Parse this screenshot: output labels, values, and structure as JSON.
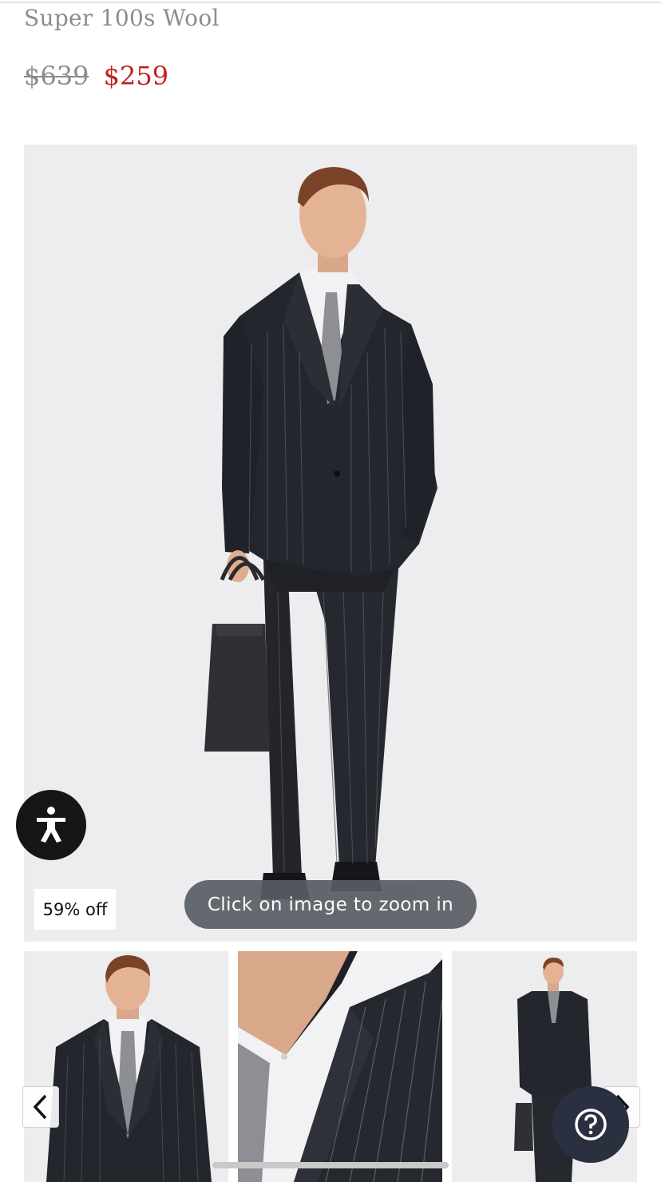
{
  "product": {
    "subtitle": "Super 100s Wool",
    "original_price": "$639",
    "sale_price": "$259"
  },
  "gallery": {
    "discount_badge": "59% off",
    "zoom_hint": "Click on image to zoom in",
    "main_image_alt": "model-in-navy-pinstripe-suit-holding-briefcase",
    "thumbnails": [
      {
        "alt": "suit-front-upper-body"
      },
      {
        "alt": "suit-lapel-closeup"
      },
      {
        "alt": "suit-full-length"
      }
    ]
  },
  "icons": {
    "accessibility": "accessibility-person-icon",
    "help": "question-mark-icon",
    "prev": "chevron-left-icon",
    "next": "chevron-right-icon"
  },
  "colors": {
    "sale_price": "#c41f1f",
    "original_price": "#8c8c8c",
    "image_background": "#edecef",
    "help_button": "#2b3041"
  }
}
